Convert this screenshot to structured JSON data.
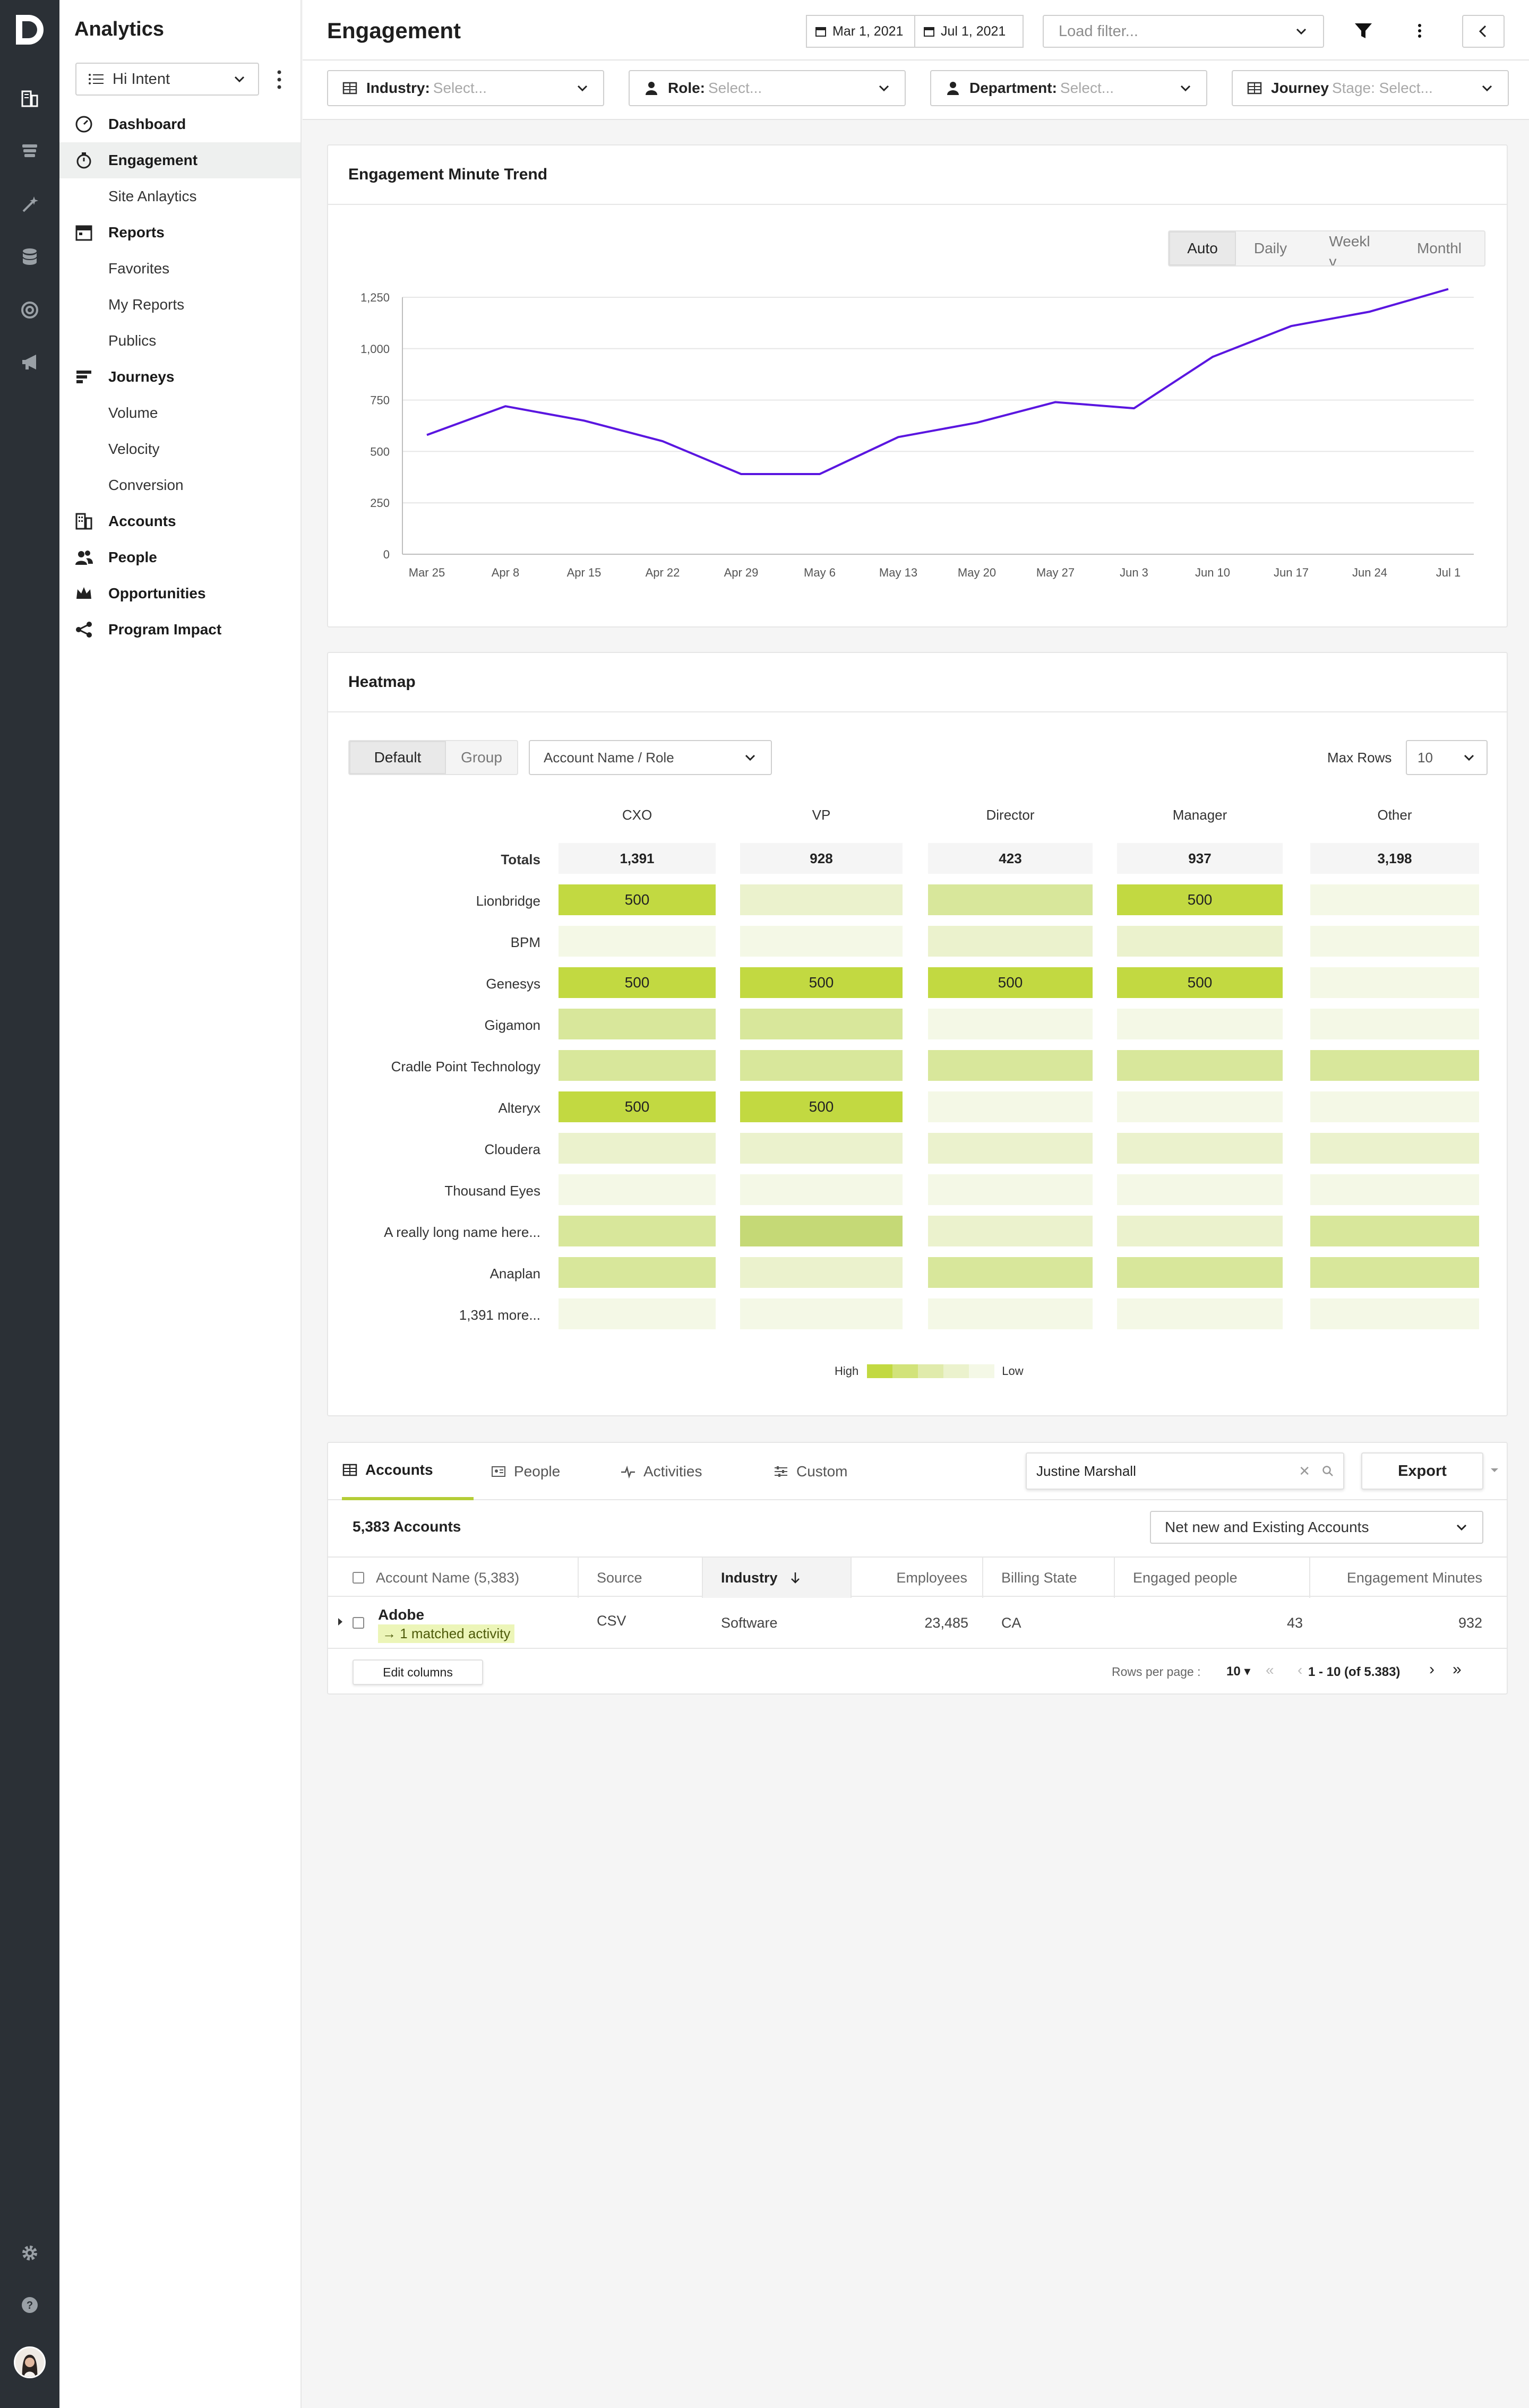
{
  "sidebar": {
    "app_title": "Analytics",
    "intent_value": "Hi Intent",
    "items": [
      {
        "label": "Dashboard",
        "type": "top"
      },
      {
        "label": "Engagement",
        "type": "top",
        "active": true
      },
      {
        "label": "Site Anlaytics",
        "type": "sub"
      },
      {
        "label": "Reports",
        "type": "top"
      },
      {
        "label": "Favorites",
        "type": "sub"
      },
      {
        "label": "My Reports",
        "type": "sub"
      },
      {
        "label": "Publics",
        "type": "sub"
      },
      {
        "label": "Journeys",
        "type": "top"
      },
      {
        "label": "Volume",
        "type": "sub"
      },
      {
        "label": "Velocity",
        "type": "sub"
      },
      {
        "label": "Conversion",
        "type": "sub"
      },
      {
        "label": "Accounts",
        "type": "top"
      },
      {
        "label": "People",
        "type": "top"
      },
      {
        "label": "Opportunities",
        "type": "top"
      },
      {
        "label": "Program Impact",
        "type": "top"
      }
    ]
  },
  "header": {
    "title": "Engagement",
    "date_start": "Mar 1, 2021",
    "date_end": "Jul 1, 2021",
    "load_filter_placeholder": "Load filter..."
  },
  "filters": [
    {
      "label": "Industry:",
      "placeholder": "Select..."
    },
    {
      "label": "Role:",
      "placeholder": "Select..."
    },
    {
      "label": "Department:",
      "placeholder": "Select..."
    },
    {
      "label": "Journey",
      "placeholder": "Stage: Select..."
    }
  ],
  "trend": {
    "title": "Engagement Minute Trend",
    "granularity": [
      "Auto",
      "Daily",
      "Weekl\ny",
      "Monthl"
    ],
    "granularity_selected": "Auto"
  },
  "chart_data": {
    "type": "line",
    "title": "Engagement Minute Trend",
    "x": [
      "Mar 25",
      "Apr 8",
      "Apr 15",
      "Apr 22",
      "Apr 29",
      "May 6",
      "May 13",
      "May 20",
      "May 27",
      "Jun 3",
      "Jun 10",
      "Jun 17",
      "Jun 24",
      "Jul 1"
    ],
    "y_ticks": [
      0,
      250,
      500,
      750,
      1000,
      1250
    ],
    "y_tick_labels": [
      "0",
      "250",
      "500",
      "750",
      "1,000",
      "1,250"
    ],
    "ylim": [
      0,
      1250
    ],
    "series": [
      {
        "color": "#5a16e0",
        "values": [
          580,
          720,
          650,
          550,
          390,
          390,
          570,
          640,
          740,
          710,
          960,
          1110,
          1180,
          1290
        ]
      }
    ],
    "grid": true
  },
  "heatmap": {
    "title": "Heatmap",
    "mode_options": [
      "Default",
      "Group"
    ],
    "mode_selected": "Default",
    "group_by": "Account Name / Role",
    "max_rows_label": "Max Rows",
    "max_rows_value": "10",
    "totals_label": "Totals",
    "columns": [
      "CXO",
      "VP",
      "Director",
      "Manager",
      "Other"
    ],
    "totals": [
      "1,391",
      "928",
      "423",
      "937",
      "3,198"
    ],
    "rows": [
      {
        "name": "Lionbridge",
        "levels": [
          5,
          2,
          3,
          5,
          1
        ],
        "labels": [
          "500",
          "",
          "",
          "500",
          ""
        ]
      },
      {
        "name": "BPM",
        "levels": [
          1,
          1,
          2,
          2,
          1
        ],
        "labels": [
          "",
          "",
          "",
          "",
          ""
        ]
      },
      {
        "name": "Genesys",
        "levels": [
          5,
          5,
          5,
          5,
          1
        ],
        "labels": [
          "500",
          "500",
          "500",
          "500",
          ""
        ]
      },
      {
        "name": "Gigamon",
        "levels": [
          3,
          3,
          1,
          1,
          1
        ],
        "labels": [
          "",
          "",
          "",
          "",
          ""
        ]
      },
      {
        "name": "Cradle Point Technology",
        "levels": [
          3,
          3,
          3,
          3,
          3
        ],
        "labels": [
          "",
          "",
          "",
          "",
          ""
        ]
      },
      {
        "name": "Alteryx",
        "levels": [
          5,
          5,
          1,
          1,
          1
        ],
        "labels": [
          "500",
          "500",
          "",
          "",
          ""
        ]
      },
      {
        "name": "Cloudera",
        "levels": [
          2,
          2,
          2,
          2,
          2
        ],
        "labels": [
          "",
          "",
          "",
          "",
          ""
        ]
      },
      {
        "name": "Thousand Eyes",
        "levels": [
          1,
          1,
          1,
          1,
          1
        ],
        "labels": [
          "",
          "",
          "",
          "",
          ""
        ]
      },
      {
        "name": "A really long name here...",
        "levels": [
          3,
          4,
          2,
          2,
          3
        ],
        "labels": [
          "",
          "",
          "",
          "",
          ""
        ]
      },
      {
        "name": "Anaplan",
        "levels": [
          3,
          2,
          3,
          3,
          3
        ],
        "labels": [
          "",
          "",
          "",
          "",
          ""
        ]
      },
      {
        "name": "1,391 more...",
        "levels": [
          1,
          1,
          1,
          1,
          1
        ],
        "labels": [
          "",
          "",
          "",
          "",
          ""
        ]
      }
    ],
    "legend_high": "High",
    "legend_low": "Low"
  },
  "table": {
    "tabs": [
      "Accounts",
      "People",
      "Activities",
      "Custom"
    ],
    "tab_selected": "Accounts",
    "search_value": "Justine Marshall",
    "export_label": "Export",
    "count_label": "5,383 Accounts",
    "view_select": "Net new and Existing Accounts",
    "columns": [
      "Account Name (5,383)",
      "Source",
      "Industry",
      "Employees",
      "Billing State",
      "Engaged people",
      "Engagement Minutes"
    ],
    "sorted_column": "Industry",
    "rows": [
      {
        "name": "Adobe",
        "activity": "1 matched activity",
        "source": "CSV",
        "industry": "Software",
        "employees": "23,485",
        "state": "CA",
        "engaged": "43",
        "minutes": "932"
      }
    ],
    "edit_columns": "Edit columns",
    "rows_per_page_label": "Rows per page :",
    "rows_per_page": "10",
    "page_range": "1 - 10 (of 5.383)"
  },
  "colors": {
    "accent_green": "#b4cd37",
    "line_purple": "#5a16e0",
    "rail_bg": "#2b3036"
  }
}
